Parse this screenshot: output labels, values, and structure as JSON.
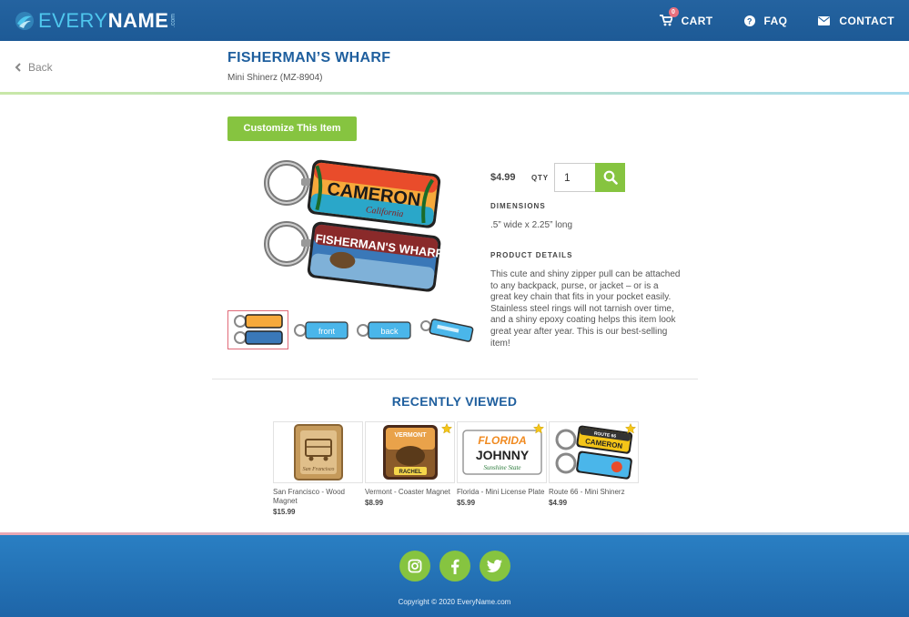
{
  "brand": {
    "every": "EVERY",
    "name": "NAME",
    "dotcom": ".com"
  },
  "nav": {
    "cart_label": "CART",
    "cart_count": "0",
    "faq_label": "FAQ",
    "contact_label": "CONTACT"
  },
  "back_label": "Back",
  "product": {
    "title": "FISHERMAN’S WHARF",
    "subtitle": "Mini Shinerz (MZ-8904)",
    "customize_label": "Customize This Item",
    "price": "$4.99",
    "qty_label": "QTY",
    "qty_value": "1",
    "dimensions_heading": "DIMENSIONS",
    "dimensions": ".5” wide x 2.25” long",
    "details_heading": "PRODUCT DETAILS",
    "details": "This cute and shiny zipper pull can be attached to any backpack, purse, or jacket – or is a great key chain that fits in your pocket easily. Stainless steel rings will not tarnish over time, and a shiny epoxy coating helps this item look great year after year. This is our best-selling item!",
    "image_text_top": "CAMERON",
    "image_text_top_script": "California",
    "image_text_bottom": "FISHERMAN'S WHARF",
    "thumbs": [
      {
        "label": ""
      },
      {
        "label": "front"
      },
      {
        "label": "back"
      },
      {
        "label": ""
      }
    ]
  },
  "recently_viewed": {
    "heading": "RECENTLY VIEWED",
    "items": [
      {
        "name": "San Francisco - Wood Magnet",
        "price": "$15.99",
        "img_text": "San Francisco"
      },
      {
        "name": "Vermont - Coaster Magnet",
        "price": "$8.99",
        "img_text": "RACHEL",
        "img_text2": "VERMONT"
      },
      {
        "name": "Florida - Mini License Plate",
        "price": "$5.99",
        "img_text": "JOHNNY",
        "img_text2": "FLORIDA",
        "img_text3": "Sunshine State"
      },
      {
        "name": "Route 66 - Mini Shinerz",
        "price": "$4.99",
        "img_text": "CAMERON",
        "img_text2": "ROUTE 66"
      }
    ]
  },
  "footer": {
    "copyright": "Copyright © 2020 EveryName.com"
  },
  "colors": {
    "nav_blue": "#1f5f9e",
    "accent_green": "#86c440",
    "badge_pink": "#e8707e"
  }
}
